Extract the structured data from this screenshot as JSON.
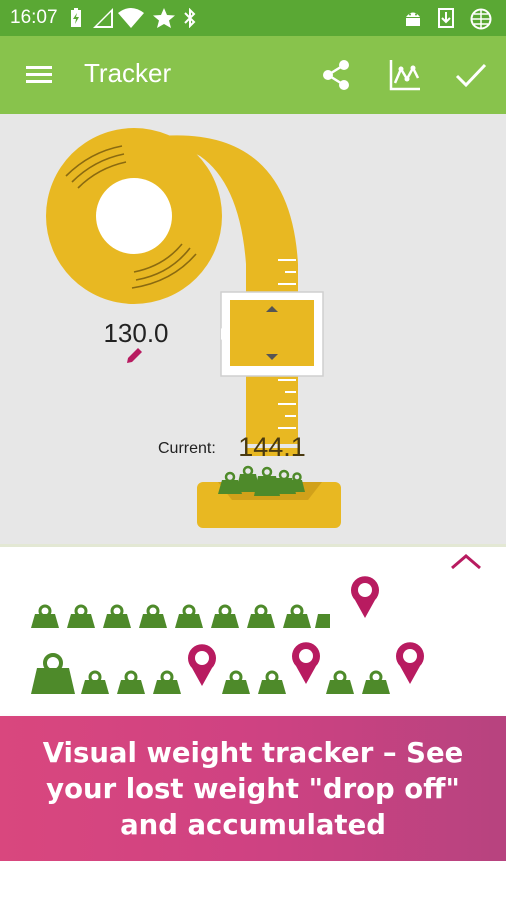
{
  "status_bar": {
    "time": "16:07",
    "icons": [
      "battery-charging-icon",
      "signal-icon",
      "wifi-icon",
      "star-icon",
      "bluetooth-icon",
      "android-icon",
      "download-icon",
      "globe-icon"
    ]
  },
  "app_bar": {
    "title": "Tracker",
    "actions": [
      "share-icon",
      "chart-icon",
      "check-icon"
    ]
  },
  "tracker": {
    "start_weight": "130.0",
    "current_label": "Current:",
    "current_weight": "144.1"
  },
  "caption": "Visual weight tracker – See your lost weight \"drop off\" and accumulated",
  "colors": {
    "status_bar": "#5aa834",
    "app_bar": "#88c34c",
    "tape": "#e8b822",
    "weight_green": "#4e8a2a",
    "pin": "#b81b60",
    "overlay": "#d4457f"
  }
}
